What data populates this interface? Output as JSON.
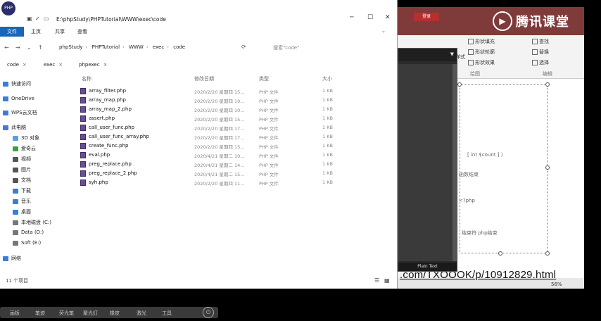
{
  "explorer": {
    "title": "E:\\phpStudy\\PHPTutorial\\WWW\\exec\\code",
    "logo_text": "PHP",
    "menu": {
      "file": "文件",
      "home": "主页",
      "share": "共享",
      "view": "查看"
    },
    "crumbs": [
      "phpStudy",
      "PHPTutorial",
      "WWW",
      "exec",
      "code"
    ],
    "search_placeholder": "搜索\"code\"",
    "quick_tabs": [
      "code",
      "exec",
      "phpexec"
    ],
    "columns": {
      "name": "名称",
      "date": "修改日期",
      "type": "类型",
      "size": "大小"
    },
    "files": [
      {
        "name": "array_filter.php",
        "date": "2020/2/20 星期四 15...",
        "type": "PHP 文件",
        "size": "1 KB"
      },
      {
        "name": "array_map.php",
        "date": "2020/2/20 星期四 10...",
        "type": "PHP 文件",
        "size": "1 KB"
      },
      {
        "name": "array_map_2.php",
        "date": "2020/2/20 星期四 10...",
        "type": "PHP 文件",
        "size": "1 KB"
      },
      {
        "name": "assert.php",
        "date": "2020/2/20 星期四 15...",
        "type": "PHP 文件",
        "size": "1 KB"
      },
      {
        "name": "call_user_func.php",
        "date": "2020/2/20 星期四 17...",
        "type": "PHP 文件",
        "size": "1 KB"
      },
      {
        "name": "call_user_func_array.php",
        "date": "2020/2/20 星期四 17...",
        "type": "PHP 文件",
        "size": "1 KB"
      },
      {
        "name": "create_func.php",
        "date": "2020/2/20 星期四 15...",
        "type": "PHP 文件",
        "size": "1 KB"
      },
      {
        "name": "eval.php",
        "date": "2020/4/21 星期二 10...",
        "type": "PHP 文件",
        "size": "1 KB"
      },
      {
        "name": "preg_replace.php",
        "date": "2020/4/21 星期二 14...",
        "type": "PHP 文件",
        "size": "1 KB"
      },
      {
        "name": "preg_replace_2.php",
        "date": "2020/4/21 星期二 15...",
        "type": "PHP 文件",
        "size": "1 KB"
      },
      {
        "name": "syh.php",
        "date": "2020/2/20 星期四 11...",
        "type": "PHP 文件",
        "size": "1 KB"
      }
    ],
    "sidebar": [
      {
        "label": "快速访问",
        "color": "#3b7dd8"
      },
      {
        "label": "OneDrive",
        "color": "#3b7dd8"
      },
      {
        "label": "WPS云文档",
        "color": "#3b7dd8"
      },
      {
        "label": "此电脑",
        "color": "#3b7dd8"
      },
      {
        "label": "3D 对象",
        "color": "#5aa0e0"
      },
      {
        "label": "爱奇云",
        "color": "#36a23a"
      },
      {
        "label": "视频",
        "color": "#555555"
      },
      {
        "label": "图片",
        "color": "#555555"
      },
      {
        "label": "文档",
        "color": "#555555"
      },
      {
        "label": "下载",
        "color": "#3b7dd8"
      },
      {
        "label": "音乐",
        "color": "#3b7dd8"
      },
      {
        "label": "桌面",
        "color": "#3b7dd8"
      },
      {
        "label": "本地磁盘 (C:)",
        "color": "#777777"
      },
      {
        "label": "Data (D:)",
        "color": "#777777"
      },
      {
        "label": "Soft (E:)",
        "color": "#777777"
      },
      {
        "label": "网络",
        "color": "#3b7dd8"
      }
    ],
    "status": "11 个项目"
  },
  "ppt": {
    "top_button": "登录",
    "ribbon": [
      "形状填充",
      "形状轮廓",
      "形状效果",
      "快速样式",
      "查找",
      "替换",
      "选择",
      "绘图",
      "编辑"
    ],
    "slide_lines": [
      "[ int $count ] )",
      "函数结束",
      "<?php",
      "结束符 php结束"
    ],
    "url": ".com/TXOOOK/p/10912829.html",
    "zoom": "56%"
  },
  "brand": {
    "name": "腾讯课堂"
  },
  "editor": {
    "footer": "Plain Text"
  },
  "dock": [
    "画板",
    "笔迹",
    "荧光笔",
    "聚光灯",
    "橡皮",
    "激光",
    "工具"
  ]
}
